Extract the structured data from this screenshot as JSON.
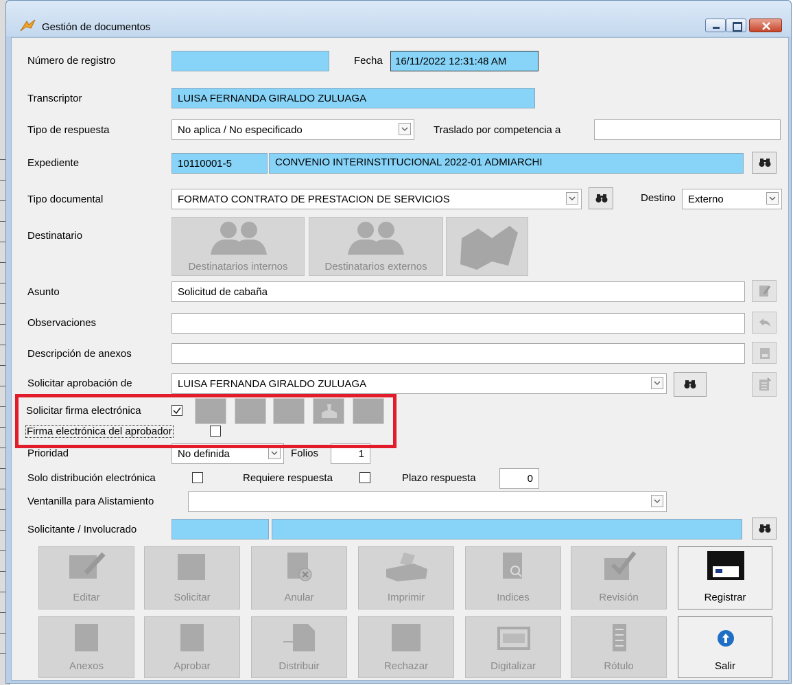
{
  "window": {
    "title": "Gestión de documentos"
  },
  "form": {
    "numero_registro": {
      "label": "Número de registro",
      "value": ""
    },
    "fecha": {
      "label": "Fecha",
      "value": "16/11/2022 12:31:48 AM"
    },
    "transcriptor": {
      "label": "Transcriptor",
      "value": "LUISA FERNANDA GIRALDO ZULUAGA"
    },
    "tipo_respuesta": {
      "label": "Tipo de respuesta",
      "value": "No aplica / No especificado"
    },
    "traslado": {
      "label": "Traslado por competencia a",
      "value": ""
    },
    "expediente": {
      "label": "Expediente",
      "code": "10110001-5",
      "name": "CONVENIO INTERINSTITUCIONAL 2022-01 ADMIARCHI"
    },
    "tipo_documental": {
      "label": "Tipo documental",
      "value": "FORMATO CONTRATO DE PRESTACION DE SERVICIOS"
    },
    "destino": {
      "label": "Destino",
      "value": "Externo"
    },
    "destinatario": {
      "label": "Destinatario",
      "internos": "Destinatarios internos",
      "externos": "Destinatarios externos"
    },
    "asunto": {
      "label": "Asunto",
      "value": "Solicitud de cabaña"
    },
    "observaciones": {
      "label": "Observaciones",
      "value": ""
    },
    "descripcion_anexos": {
      "label": "Descripción de anexos",
      "value": ""
    },
    "solicitar_aprobacion": {
      "label": "Solicitar aprobación de",
      "value": "LUISA FERNANDA GIRALDO ZULUAGA"
    },
    "solicitar_firma": {
      "label": "Solicitar firma electrónica",
      "checked": true
    },
    "firma_aprobador": {
      "label": "Firma electrónica del aprobador",
      "checked": false
    },
    "prioridad": {
      "label": "Prioridad",
      "value": "No definida"
    },
    "folios": {
      "label": "Folios",
      "value": "1"
    },
    "solo_distribucion": {
      "label": "Solo distribución electrónica",
      "checked": false
    },
    "requiere_respuesta": {
      "label": "Requiere respuesta",
      "checked": false
    },
    "plazo_respuesta": {
      "label": "Plazo respuesta",
      "value": "0"
    },
    "ventanilla": {
      "label": "Ventanilla para Alistamiento",
      "value": ""
    },
    "solicitante": {
      "label": "Solicitante / Involucrado",
      "code": "",
      "name": ""
    }
  },
  "buttons_row1": [
    "Editar",
    "Solicitar",
    "Anular",
    "Imprimir",
    "Indices",
    "Revisión",
    "Registrar"
  ],
  "buttons_row2": [
    "Anexos",
    "Aprobar",
    "Distribuir",
    "Rechazar",
    "Digitalizar",
    "Rótulo",
    "Salir"
  ],
  "colors": {
    "field_blue": "#87d4f8",
    "highlight_red": "#e21c2a",
    "disabled_text": "#8a8a8a"
  }
}
